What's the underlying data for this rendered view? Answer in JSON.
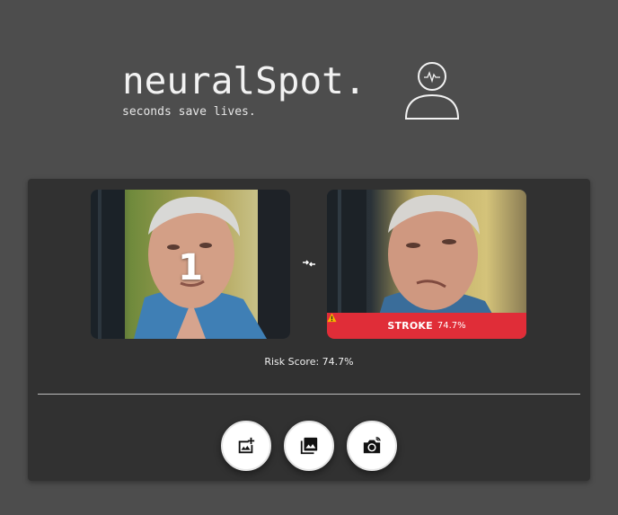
{
  "brand": {
    "title": "neuralSpot.",
    "tagline": "seconds save lives."
  },
  "header": {
    "profile_icon": "user-brain-icon"
  },
  "comparison": {
    "original": {
      "frame_number": "1"
    },
    "swap_icon": "swap-arrows-icon",
    "analyzed": {
      "status_icon": "warning-icon",
      "status_label": "STROKE",
      "status_score": "74.7%"
    }
  },
  "risk": {
    "text": "Risk Score: 74.7%"
  },
  "actions": [
    {
      "icon": "add-photo-icon"
    },
    {
      "icon": "photo-library-icon"
    },
    {
      "icon": "switch-camera-icon"
    }
  ],
  "colors": {
    "background": "#4d4d4d",
    "card": "#313131",
    "alert": "#e02d38",
    "button": "#ffffff"
  }
}
